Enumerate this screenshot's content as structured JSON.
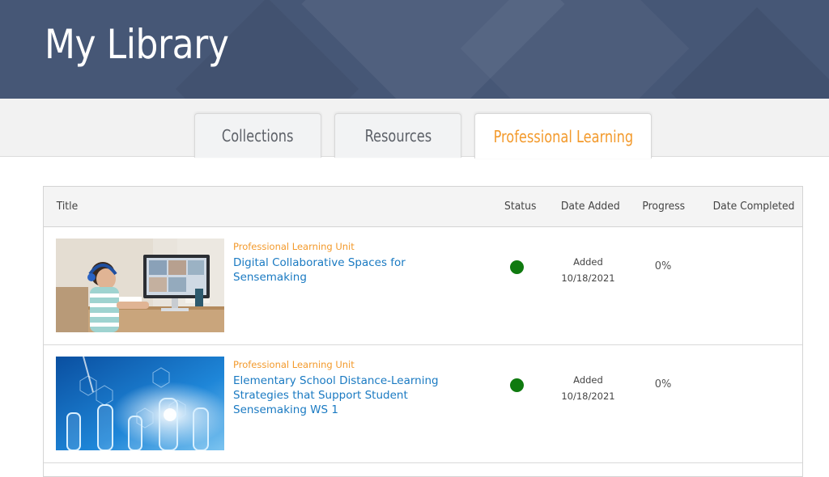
{
  "header": {
    "title": "My Library"
  },
  "tabs": [
    {
      "label": "Collections",
      "active": false
    },
    {
      "label": "Resources",
      "active": false
    },
    {
      "label": "Professional Learning",
      "active": true
    }
  ],
  "table": {
    "columns": [
      "Title",
      "Status",
      "Date Added",
      "Progress",
      "Date Completed"
    ],
    "rows": [
      {
        "kicker": "Professional Learning Unit",
        "title": "Digital Collaborative Spaces for Sensemaking",
        "status_color": "#0f7a0f",
        "added_label": "Added",
        "date_added": "10/18/2021",
        "progress": "0%",
        "date_completed": ""
      },
      {
        "kicker": "Professional Learning Unit",
        "title": "Elementary School Distance-Learning Strategies that Support Student Sensemaking WS 1",
        "status_color": "#0f7a0f",
        "added_label": "Added",
        "date_added": "10/18/2021",
        "progress": "0%",
        "date_completed": ""
      }
    ]
  },
  "colors": {
    "banner": "#465776",
    "accent": "#f39a2c",
    "link": "#1a7ac2",
    "status_active": "#0f7a0f"
  }
}
